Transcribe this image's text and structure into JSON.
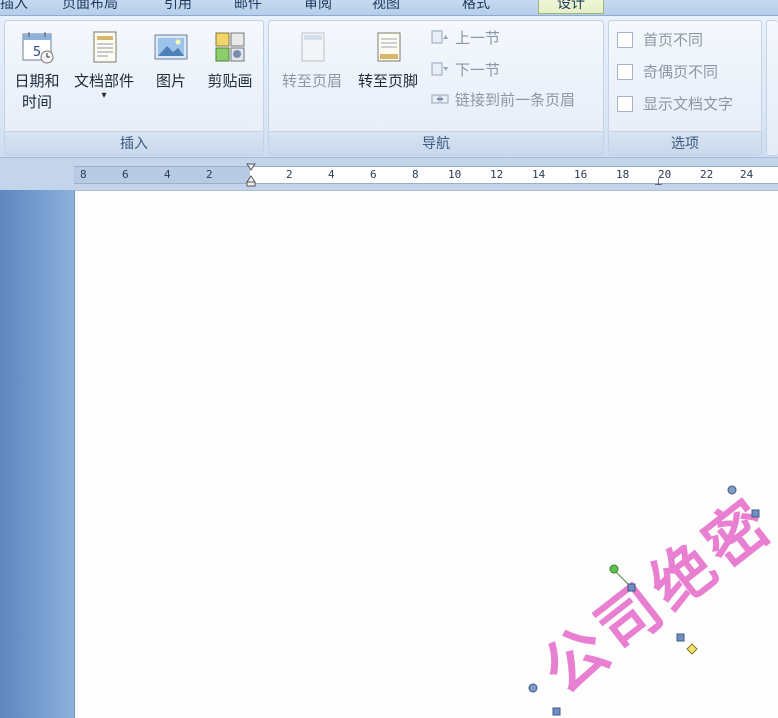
{
  "tabs": [
    "插入",
    "页面布局",
    "引用",
    "邮件",
    "审阅",
    "视图",
    "格式",
    "设计"
  ],
  "ribbon": {
    "insert_group": {
      "label": "插入",
      "buttons": [
        {
          "label": "日期和时间",
          "icon": "calendar-icon"
        },
        {
          "label": "文档部件",
          "icon": "document-parts-icon"
        },
        {
          "label": "图片",
          "icon": "picture-icon"
        },
        {
          "label": "剪贴画",
          "icon": "clipart-icon"
        }
      ]
    },
    "nav_group": {
      "label": "导航",
      "big_buttons": [
        {
          "label": "转至页眉",
          "icon": "goto-header-icon"
        },
        {
          "label": "转至页脚",
          "icon": "goto-footer-icon"
        }
      ],
      "small_buttons": [
        {
          "label": "上一节",
          "icon": "previous-section-icon"
        },
        {
          "label": "下一节",
          "icon": "next-section-icon"
        },
        {
          "label": "链接到前一条页眉",
          "icon": "link-previous-icon"
        }
      ]
    },
    "options_group": {
      "label": "选项",
      "checkboxes": [
        {
          "label": "首页不同",
          "checked": false
        },
        {
          "label": "奇偶页不同",
          "checked": false
        },
        {
          "label": "显示文档文字",
          "checked": false
        }
      ]
    }
  },
  "ruler": {
    "left_numbers": [
      "8",
      "6",
      "4",
      "2"
    ],
    "right_numbers": [
      "2",
      "4",
      "6",
      "8",
      "10",
      "12",
      "14",
      "16",
      "18",
      "20",
      "22",
      "24"
    ]
  },
  "wordart": {
    "text": "公司绝密",
    "color": "#e97fd0"
  },
  "colors": {
    "ribbon_bg": "#dbe6f5",
    "active_tab": "#e6f0c6",
    "panel_blue": "#7aa0d2"
  }
}
